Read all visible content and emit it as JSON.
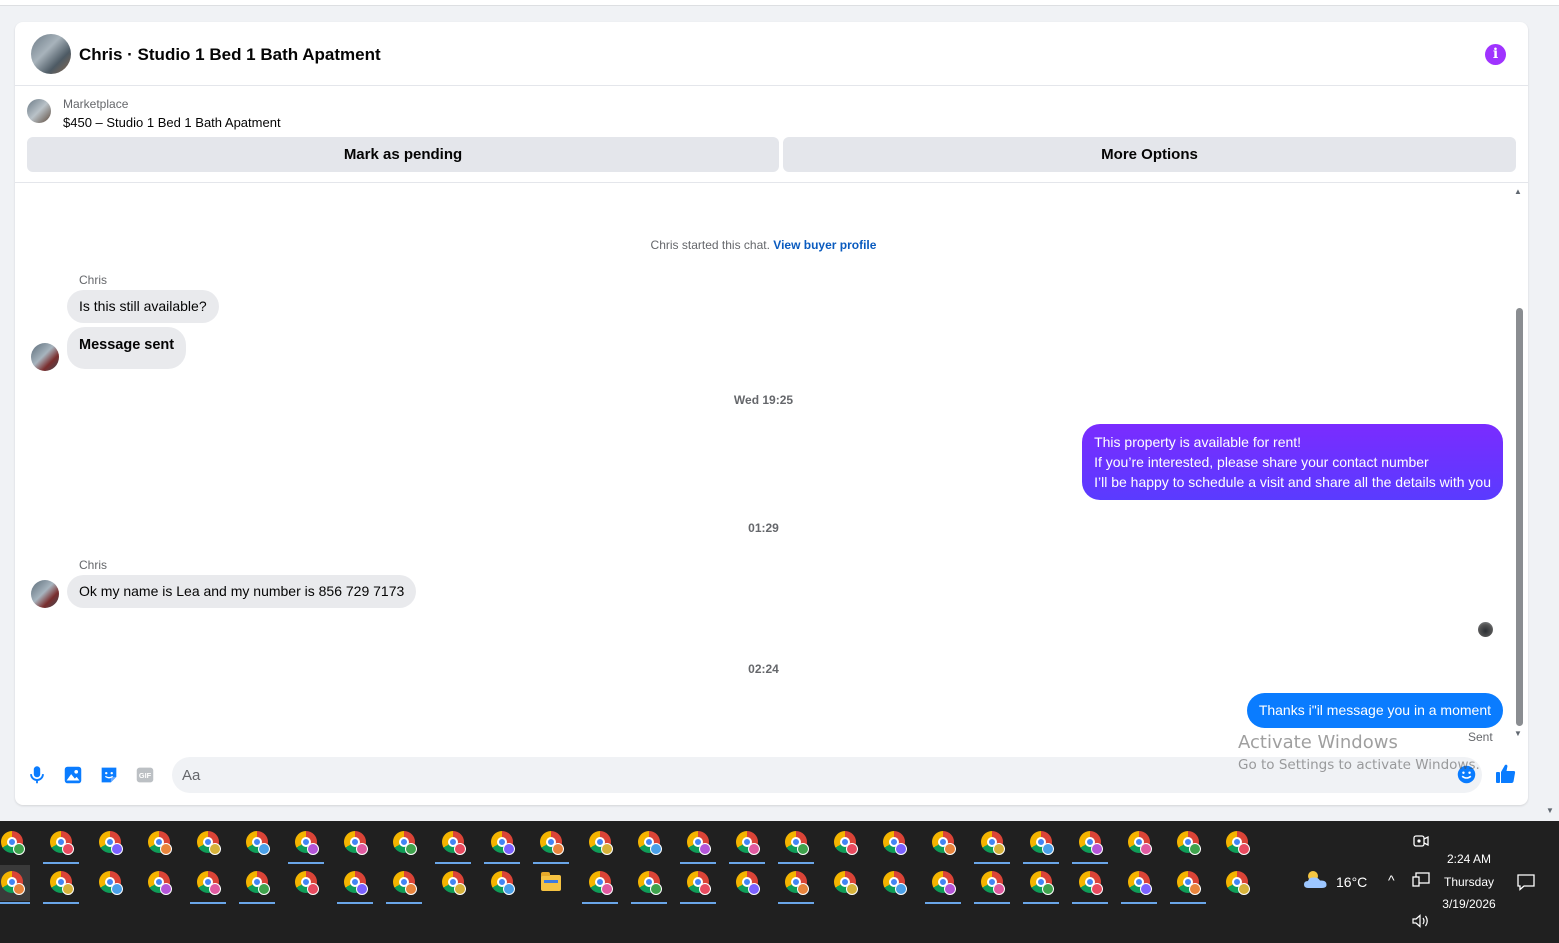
{
  "header": {
    "title": "Chris · Studio 1 Bed 1 Bath Apatment"
  },
  "listing": {
    "label": "Marketplace",
    "title": "$450 – Studio 1 Bed 1 Bath Apatment",
    "mark_pending_label": "Mark as pending",
    "more_options_label": "More Options"
  },
  "conversation": {
    "system_note": "Chris started this chat.",
    "system_link": "View buyer profile",
    "sender_1": "Chris",
    "msg_1": "Is this still available?",
    "msg_2": "Message sent",
    "time_1": "Wed 19:25",
    "out_1_line_1": "This property is available for rent!",
    "out_1_line_2": "If you’re interested, please share your contact number",
    "out_1_line_3": "I’ll be happy to schedule a visit and share all the details with you",
    "time_2": "01:29",
    "sender_2": "Chris",
    "msg_3": "Ok my name is Lea and my number is 856 729 7173",
    "time_3": "02:24",
    "out_2": "Thanks i\"il message you in a moment",
    "status": "Sent"
  },
  "composer": {
    "placeholder": "Aa"
  },
  "watermark": {
    "title": "Activate Windows",
    "subtitle": "Go to Settings to activate Windows."
  },
  "taskbar": {
    "temperature": "16°C",
    "time": "2:24 AM",
    "day": "Thursday",
    "date": "3/19/2026"
  },
  "colors": {
    "accent_purple": "#7a2cff",
    "accent_blue": "#0a7cff",
    "info_purple": "#a033ff",
    "link_blue": "#0a5bbf"
  },
  "icons": [
    "info-icon",
    "microphone-icon",
    "photo-icon",
    "sticker-icon",
    "gif-icon",
    "emoji-icon",
    "thumbs-up-icon",
    "chrome-profile-icon",
    "file-explorer-icon",
    "weather-icon",
    "chevron-up-icon",
    "network-icon",
    "camera-icon",
    "volume-icon",
    "notification-icon"
  ]
}
